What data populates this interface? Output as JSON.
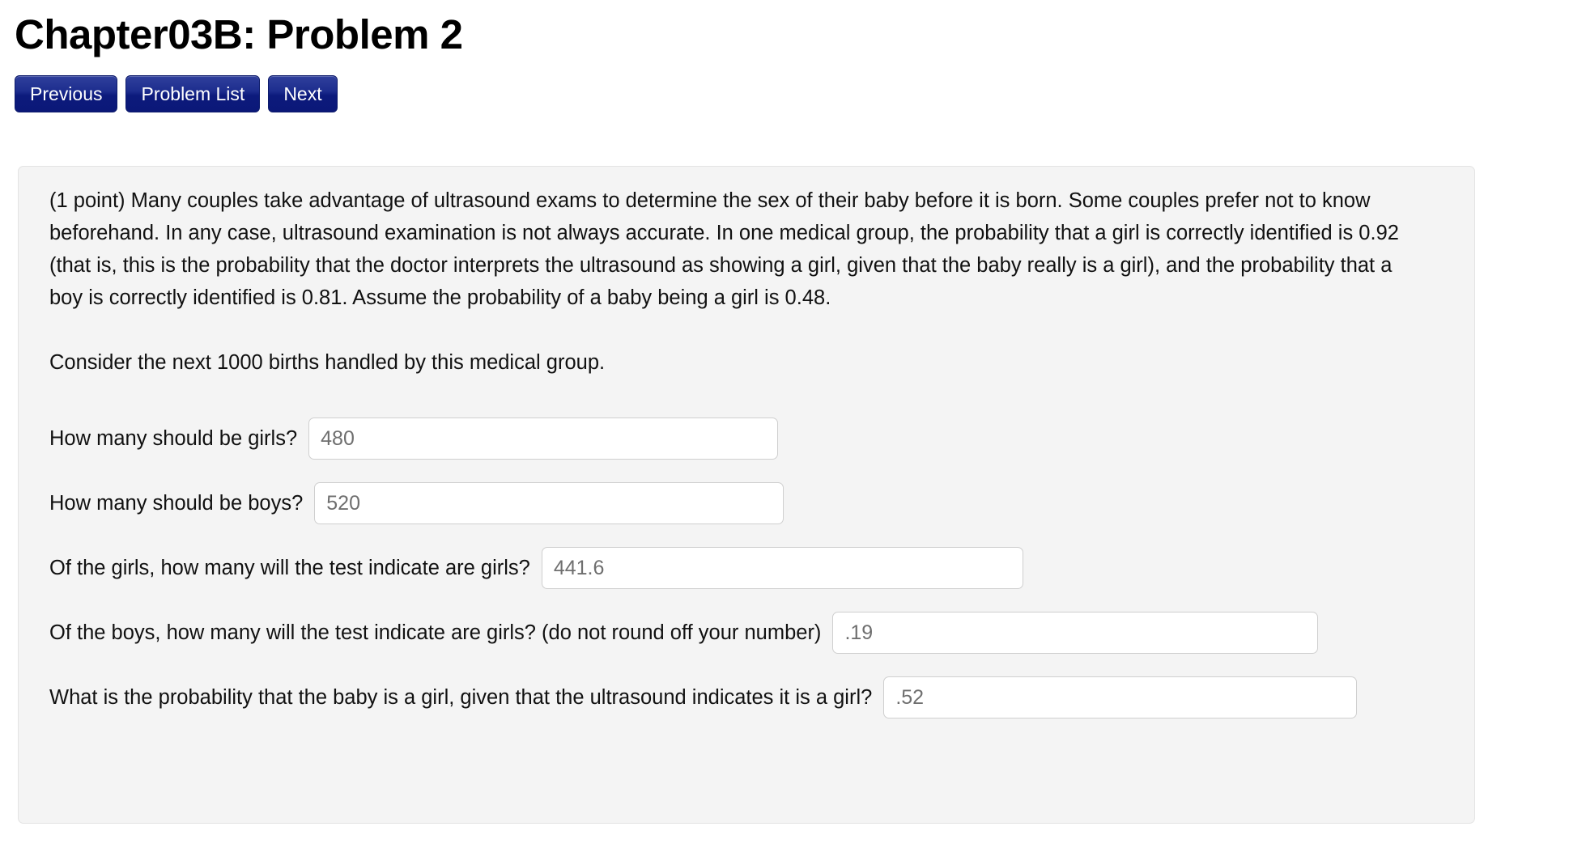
{
  "page": {
    "title": "Chapter03B: Problem 2"
  },
  "nav": {
    "previous_label": "Previous",
    "problem_list_label": "Problem List",
    "next_label": "Next"
  },
  "problem": {
    "statement": "(1 point) Many couples take advantage of ultrasound exams to determine the sex of their baby before it is born. Some couples prefer not to know beforehand. In any case, ultrasound examination is not always accurate. In one medical group, the probability that a girl is correctly identified is 0.92 (that is, this is the probability that the doctor interprets the ultrasound as showing a girl, given that the baby really is a girl), and the probability that a boy is correctly identified is 0.81. Assume the probability of a baby being a girl is 0.48.",
    "instruction": "Consider the next 1000 births handled by this medical group.",
    "questions": [
      {
        "label": "How many should be girls?",
        "value": "480"
      },
      {
        "label": "How many should be boys?",
        "value": "520"
      },
      {
        "label": "Of the girls, how many will the test indicate are girls?",
        "value": "441.6"
      },
      {
        "label": "Of the boys, how many will the test indicate are girls? (do not round off your number)",
        "value": ".19"
      },
      {
        "label": "What is the probability that the baby is a girl, given that the ultrasound indicates it is a girl?",
        "value": ".52"
      }
    ]
  },
  "colors": {
    "button_navy_top": "#30409c",
    "button_navy_bottom": "#0b1878",
    "panel_background": "#f4f4f4",
    "panel_border": "#e3e3e3",
    "input_border": "#cfcfcf",
    "input_text": "#6f6f6f"
  }
}
